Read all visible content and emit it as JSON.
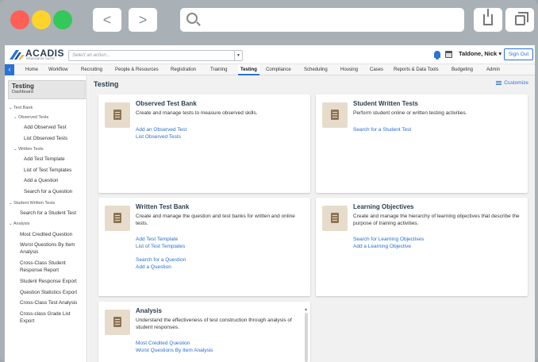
{
  "browser": {
    "back": "<",
    "forward": ">"
  },
  "topbar": {
    "brand_name": "ACADIS",
    "brand_tagline": "READINESS SUITE",
    "action_placeholder": "Select an action...",
    "user_name": "Taldone, Nick",
    "sign_out": "Sign Out"
  },
  "menu": {
    "items": [
      "Home",
      "Workflow",
      "Recruiting",
      "People & Resources",
      "Registration",
      "Training",
      "Testing",
      "Compliance",
      "Scheduling",
      "Housing",
      "Cases",
      "Reports & Data Tools",
      "Budgeting",
      "Admin"
    ],
    "active": "Testing"
  },
  "sidebar": {
    "title": "Testing",
    "subtitle": "Dashboard",
    "test_bank": "Test Bank",
    "observed_tests": "Observed Tests",
    "add_observed_test": "Add Observed Test",
    "list_observed_tests": "List Observed Tests",
    "written_tests": "Written Tests",
    "add_test_template": "Add Test Template",
    "list_test_templates": "List of Test Templates",
    "add_question": "Add a Question",
    "search_question": "Search for a Question",
    "student_written_tests": "Student Written Tests",
    "search_student_test": "Search for a Student Test",
    "analysis": "Analysis",
    "most_credited": "Most Credited Question",
    "worst_questions_1": "Worst Questions By Item",
    "worst_questions_2": "Analysis",
    "cross_class_1": "Cross-Class Student",
    "cross_class_2": "Response Report",
    "student_response_export": "Student Response Export",
    "question_stats_export": "Question Statistics Export",
    "cross_class_test_analysis": "Cross-Class Test Analysis",
    "cross_class_grade_1": "Cross-class Grade List",
    "cross_class_grade_2": "Export"
  },
  "main": {
    "title": "Testing",
    "customize": "Customize",
    "cards": [
      {
        "title": "Observed Test Bank",
        "desc": "Create and manage tests to measure observed skills.",
        "links": [
          "Add an Observed Test",
          "List Observed Tests"
        ]
      },
      {
        "title": "Student Written Tests",
        "desc": "Perform student online or written testing activities.",
        "links": [
          "Search for a Student Test"
        ]
      },
      {
        "title": "Written Test Bank",
        "desc": "Create and manage the question and test banks for written and online tests.",
        "links": [
          "Add Test Template",
          "List of Test Templates",
          "Search for a Question",
          "Add a Question"
        ]
      },
      {
        "title": "Learning Objectives",
        "desc": "Create and manage the hierarchy of learning objectives that describe the purpose of training activities.",
        "links": [
          "Search for Learning Objectives",
          "Add a Learning Objective"
        ]
      },
      {
        "title": "Analysis",
        "desc": "Understand the effectiveness of test construction through analysis of student responses.",
        "links": [
          "Most Credited Question",
          "Worst Questions By Item Analysis"
        ]
      }
    ]
  },
  "colors": {
    "accent": "#2a72d6",
    "link": "#2a6fc9",
    "card_icon_bg": "#e7dccb"
  }
}
